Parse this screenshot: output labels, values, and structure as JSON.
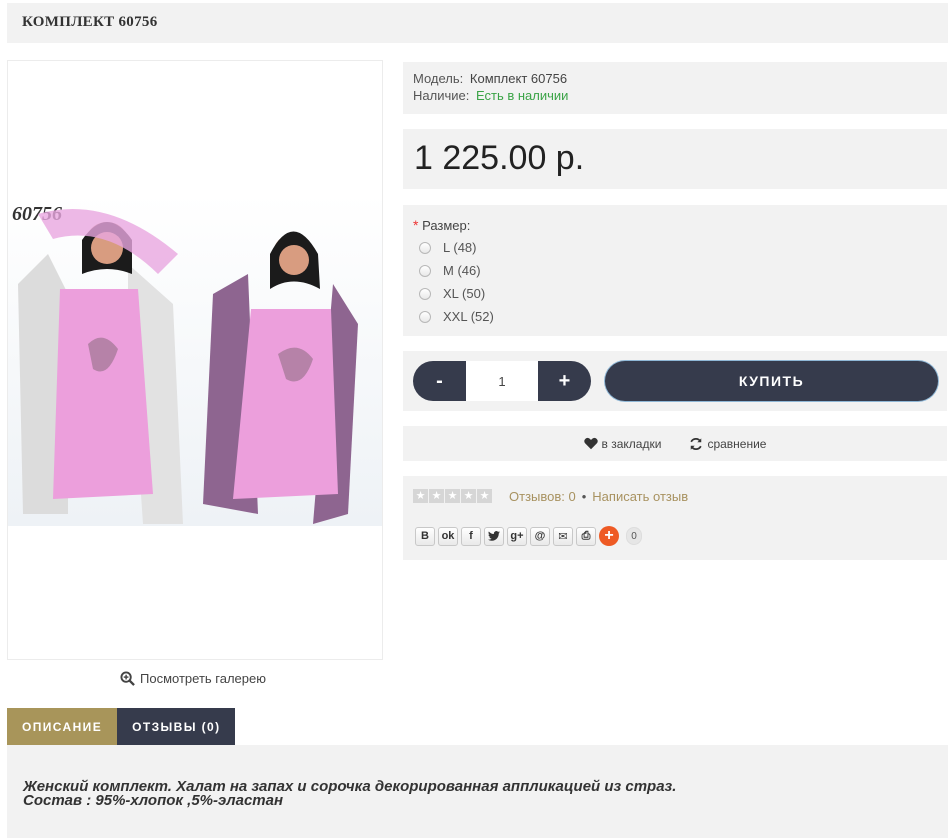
{
  "product": {
    "title": "КОМПЛЕКТ 60756",
    "image_caption": "60756",
    "gallery_link": "Посмотреть галерею"
  },
  "info": {
    "model_label": "Модель:",
    "model_value": "Комплект 60756",
    "stock_label": "Наличие:",
    "stock_value": "Есть в наличии",
    "stock_color": "#3aa346"
  },
  "price": "1 225.00 р.",
  "options": {
    "required_mark": "*",
    "label": "Размер:",
    "sizes": [
      "L (48)",
      "M (46)",
      "XL (50)",
      "XXL (52)"
    ]
  },
  "purchase": {
    "minus": "-",
    "quantity": "1",
    "plus": "+",
    "buy_label": "КУПИТЬ"
  },
  "actions": {
    "wishlist_label": "в закладки",
    "compare_label": "сравнение"
  },
  "reviews": {
    "rating": 0,
    "max_rating": 5,
    "count_label": "Отзывов: 0",
    "separator": "•",
    "write_label": "Написать отзыв"
  },
  "share": {
    "buttons": [
      "vk-icon",
      "odnoklassniki-icon",
      "facebook-icon",
      "twitter-icon",
      "google-plus-icon",
      "mail-ru-icon",
      "email-icon",
      "print-icon",
      "more-share-icon"
    ],
    "count": "0"
  },
  "tabs": [
    {
      "label": "ОПИСАНИЕ",
      "active": true
    },
    {
      "label": "ОТЗЫВЫ (0)",
      "active": false
    }
  ],
  "description": {
    "line1": "Женский комплект. Халат на запах и сорочка декорированная аппликацией из страз.",
    "line2": "Состав : 95%-хлопок ,5%-эластан"
  },
  "colors": {
    "dark_button": "#363b4c",
    "gold_accent": "#a8955a",
    "panel_bg": "#f2f2f2"
  }
}
